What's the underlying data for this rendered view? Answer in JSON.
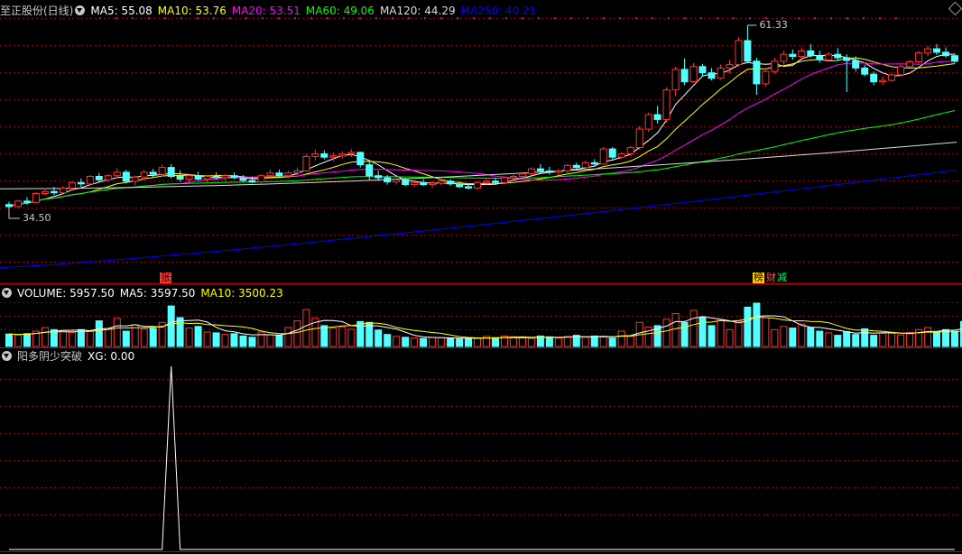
{
  "main_panel": {
    "title": "至正股份(日线)",
    "indicators": [
      {
        "label": "MA5: 55.08",
        "color": "#ffffff"
      },
      {
        "label": "MA10: 53.76",
        "color": "#ffff00"
      },
      {
        "label": "MA20: 53.51",
        "color": "#ff00ff"
      },
      {
        "label": "MA60: 49.06",
        "color": "#00ff00"
      },
      {
        "label": "MA120: 44.29",
        "color": "#dcdcdc"
      },
      {
        "label": "MA250: 40.21",
        "color": "#0000ff"
      }
    ],
    "high_label": "61.33",
    "low_label": "34.50",
    "event_tags": [
      {
        "text": "张",
        "bg": "#ff3333",
        "color": "#000000"
      },
      {
        "text": "榜",
        "bg": "#ffcc00",
        "color": "#000000"
      },
      {
        "text": "财",
        "bg": "#000000",
        "color": "#ff5555"
      },
      {
        "text": "减",
        "bg": "#000000",
        "color": "#00ff66"
      }
    ]
  },
  "volume_panel": {
    "indicators": [
      {
        "label": "VOLUME: 5957.50",
        "color": "#ffffff"
      },
      {
        "label": "MA5: 3597.50",
        "color": "#ffffff"
      },
      {
        "label": "MA10: 3500.23",
        "color": "#ffff00"
      }
    ]
  },
  "xg_panel": {
    "title": "阳多阴少突破",
    "indicators": [
      {
        "label": "XG: 0.00",
        "color": "#ffffff"
      }
    ]
  },
  "colors": {
    "up": "#ff3232",
    "down": "#54ffff",
    "grid": "#8b0000",
    "divider": "#c80000"
  },
  "chart_data": {
    "type": "candlestick",
    "price_range": [
      34.5,
      61.33
    ],
    "candles": [
      {
        "o": 35.2,
        "h": 35.6,
        "l": 34.5,
        "c": 34.9
      },
      {
        "o": 34.9,
        "h": 35.9,
        "l": 34.7,
        "c": 35.7
      },
      {
        "o": 35.7,
        "h": 36.3,
        "l": 35.2,
        "c": 35.5
      },
      {
        "o": 35.5,
        "h": 37.0,
        "l": 35.4,
        "c": 36.8
      },
      {
        "o": 36.8,
        "h": 37.6,
        "l": 36.5,
        "c": 37.1
      },
      {
        "o": 37.1,
        "h": 37.8,
        "l": 36.6,
        "c": 36.9
      },
      {
        "o": 36.9,
        "h": 37.9,
        "l": 36.8,
        "c": 37.6
      },
      {
        "o": 37.6,
        "h": 38.6,
        "l": 37.2,
        "c": 38.4
      },
      {
        "o": 38.4,
        "h": 39.0,
        "l": 37.8,
        "c": 38.2
      },
      {
        "o": 38.2,
        "h": 39.5,
        "l": 38.0,
        "c": 39.3
      },
      {
        "o": 39.3,
        "h": 39.8,
        "l": 38.5,
        "c": 38.8
      },
      {
        "o": 38.8,
        "h": 39.6,
        "l": 38.4,
        "c": 39.4
      },
      {
        "o": 39.4,
        "h": 40.5,
        "l": 39.0,
        "c": 39.9
      },
      {
        "o": 39.9,
        "h": 40.3,
        "l": 38.3,
        "c": 38.6
      },
      {
        "o": 38.6,
        "h": 39.4,
        "l": 38.0,
        "c": 39.2
      },
      {
        "o": 39.2,
        "h": 40.2,
        "l": 38.9,
        "c": 39.9
      },
      {
        "o": 39.9,
        "h": 40.4,
        "l": 39.1,
        "c": 39.6
      },
      {
        "o": 39.6,
        "h": 41.0,
        "l": 39.3,
        "c": 40.6
      },
      {
        "o": 40.6,
        "h": 41.1,
        "l": 39.0,
        "c": 39.3
      },
      {
        "o": 39.3,
        "h": 40.2,
        "l": 38.5,
        "c": 38.9
      },
      {
        "o": 38.9,
        "h": 39.6,
        "l": 38.2,
        "c": 39.4
      },
      {
        "o": 39.4,
        "h": 40.0,
        "l": 38.7,
        "c": 38.9
      },
      {
        "o": 38.9,
        "h": 39.5,
        "l": 38.4,
        "c": 39.3
      },
      {
        "o": 39.3,
        "h": 39.9,
        "l": 38.9,
        "c": 39.1
      },
      {
        "o": 39.1,
        "h": 39.6,
        "l": 38.6,
        "c": 39.4
      },
      {
        "o": 39.4,
        "h": 39.9,
        "l": 38.9,
        "c": 39.1
      },
      {
        "o": 39.1,
        "h": 39.5,
        "l": 38.5,
        "c": 38.7
      },
      {
        "o": 38.7,
        "h": 39.3,
        "l": 38.3,
        "c": 38.5
      },
      {
        "o": 38.5,
        "h": 39.6,
        "l": 38.3,
        "c": 39.4
      },
      {
        "o": 39.4,
        "h": 40.3,
        "l": 39.2,
        "c": 39.8
      },
      {
        "o": 39.8,
        "h": 40.3,
        "l": 39.1,
        "c": 39.4
      },
      {
        "o": 39.4,
        "h": 40.1,
        "l": 39.0,
        "c": 39.8
      },
      {
        "o": 39.8,
        "h": 40.6,
        "l": 39.5,
        "c": 40.1
      },
      {
        "o": 40.1,
        "h": 42.6,
        "l": 40.0,
        "c": 42.2
      },
      {
        "o": 42.2,
        "h": 43.2,
        "l": 41.6,
        "c": 42.6
      },
      {
        "o": 42.6,
        "h": 43.1,
        "l": 41.8,
        "c": 42.1
      },
      {
        "o": 42.1,
        "h": 42.8,
        "l": 41.5,
        "c": 42.3
      },
      {
        "o": 42.3,
        "h": 43.0,
        "l": 41.9,
        "c": 42.6
      },
      {
        "o": 42.6,
        "h": 43.3,
        "l": 42.1,
        "c": 42.8
      },
      {
        "o": 42.8,
        "h": 42.9,
        "l": 40.6,
        "c": 41.0
      },
      {
        "o": 41.0,
        "h": 41.7,
        "l": 38.7,
        "c": 39.4
      },
      {
        "o": 39.4,
        "h": 40.1,
        "l": 38.6,
        "c": 39.1
      },
      {
        "o": 39.1,
        "h": 39.5,
        "l": 38.1,
        "c": 38.5
      },
      {
        "o": 38.5,
        "h": 39.1,
        "l": 38.1,
        "c": 38.8
      },
      {
        "o": 38.8,
        "h": 39.1,
        "l": 37.9,
        "c": 38.1
      },
      {
        "o": 38.1,
        "h": 38.8,
        "l": 37.8,
        "c": 38.4
      },
      {
        "o": 38.4,
        "h": 38.9,
        "l": 37.9,
        "c": 38.1
      },
      {
        "o": 38.1,
        "h": 38.6,
        "l": 37.6,
        "c": 38.3
      },
      {
        "o": 38.3,
        "h": 38.8,
        "l": 38.0,
        "c": 38.6
      },
      {
        "o": 38.6,
        "h": 38.9,
        "l": 37.9,
        "c": 38.2
      },
      {
        "o": 38.2,
        "h": 38.6,
        "l": 37.6,
        "c": 37.8
      },
      {
        "o": 37.8,
        "h": 38.2,
        "l": 37.4,
        "c": 37.6
      },
      {
        "o": 37.6,
        "h": 38.6,
        "l": 37.5,
        "c": 38.4
      },
      {
        "o": 38.4,
        "h": 38.9,
        "l": 38.1,
        "c": 38.6
      },
      {
        "o": 38.6,
        "h": 39.1,
        "l": 38.2,
        "c": 38.4
      },
      {
        "o": 38.4,
        "h": 39.3,
        "l": 38.2,
        "c": 39.1
      },
      {
        "o": 39.1,
        "h": 39.6,
        "l": 38.8,
        "c": 39.3
      },
      {
        "o": 39.3,
        "h": 39.9,
        "l": 39.1,
        "c": 39.7
      },
      {
        "o": 39.7,
        "h": 40.6,
        "l": 39.5,
        "c": 40.4
      },
      {
        "o": 40.4,
        "h": 41.1,
        "l": 39.6,
        "c": 40.1
      },
      {
        "o": 40.1,
        "h": 40.7,
        "l": 39.6,
        "c": 39.9
      },
      {
        "o": 39.9,
        "h": 40.4,
        "l": 39.4,
        "c": 40.1
      },
      {
        "o": 40.1,
        "h": 41.1,
        "l": 39.9,
        "c": 40.9
      },
      {
        "o": 40.9,
        "h": 41.3,
        "l": 40.3,
        "c": 40.6
      },
      {
        "o": 40.6,
        "h": 41.6,
        "l": 40.4,
        "c": 41.3
      },
      {
        "o": 41.3,
        "h": 41.8,
        "l": 40.9,
        "c": 41.1
      },
      {
        "o": 41.1,
        "h": 43.6,
        "l": 41.0,
        "c": 43.3
      },
      {
        "o": 43.3,
        "h": 43.6,
        "l": 41.8,
        "c": 42.1
      },
      {
        "o": 42.1,
        "h": 42.8,
        "l": 41.9,
        "c": 42.6
      },
      {
        "o": 42.6,
        "h": 43.7,
        "l": 42.3,
        "c": 43.5
      },
      {
        "o": 43.5,
        "h": 46.6,
        "l": 43.2,
        "c": 46.2
      },
      {
        "o": 46.2,
        "h": 48.6,
        "l": 45.8,
        "c": 48.3
      },
      {
        "o": 48.3,
        "h": 49.6,
        "l": 47.0,
        "c": 47.6
      },
      {
        "o": 47.6,
        "h": 52.3,
        "l": 47.2,
        "c": 51.9
      },
      {
        "o": 51.9,
        "h": 55.3,
        "l": 51.0,
        "c": 54.9
      },
      {
        "o": 54.9,
        "h": 56.5,
        "l": 52.6,
        "c": 53.1
      },
      {
        "o": 53.1,
        "h": 55.8,
        "l": 52.9,
        "c": 55.3
      },
      {
        "o": 55.3,
        "h": 55.7,
        "l": 53.9,
        "c": 54.4
      },
      {
        "o": 54.4,
        "h": 55.1,
        "l": 53.3,
        "c": 53.6
      },
      {
        "o": 53.6,
        "h": 55.6,
        "l": 53.4,
        "c": 55.1
      },
      {
        "o": 55.1,
        "h": 56.3,
        "l": 54.3,
        "c": 55.6
      },
      {
        "o": 55.6,
        "h": 59.6,
        "l": 55.3,
        "c": 59.1
      },
      {
        "o": 59.1,
        "h": 61.33,
        "l": 55.8,
        "c": 56.1
      },
      {
        "o": 56.1,
        "h": 56.6,
        "l": 51.2,
        "c": 52.8
      },
      {
        "o": 52.8,
        "h": 55.1,
        "l": 52.4,
        "c": 54.6
      },
      {
        "o": 54.6,
        "h": 56.6,
        "l": 54.2,
        "c": 56.1
      },
      {
        "o": 56.1,
        "h": 57.6,
        "l": 55.6,
        "c": 57.1
      },
      {
        "o": 57.1,
        "h": 57.8,
        "l": 56.3,
        "c": 56.8
      },
      {
        "o": 56.8,
        "h": 58.1,
        "l": 56.5,
        "c": 57.6
      },
      {
        "o": 57.6,
        "h": 58.6,
        "l": 56.6,
        "c": 56.9
      },
      {
        "o": 56.9,
        "h": 57.6,
        "l": 55.9,
        "c": 56.3
      },
      {
        "o": 56.3,
        "h": 57.4,
        "l": 56.1,
        "c": 57.1
      },
      {
        "o": 57.1,
        "h": 58.0,
        "l": 56.2,
        "c": 56.6
      },
      {
        "o": 56.6,
        "h": 57.1,
        "l": 51.6,
        "c": 56.2
      },
      {
        "o": 56.2,
        "h": 56.8,
        "l": 54.6,
        "c": 55.1
      },
      {
        "o": 55.1,
        "h": 55.6,
        "l": 53.9,
        "c": 54.2
      },
      {
        "o": 54.2,
        "h": 54.6,
        "l": 52.6,
        "c": 53.1
      },
      {
        "o": 53.1,
        "h": 53.9,
        "l": 52.6,
        "c": 53.3
      },
      {
        "o": 53.3,
        "h": 54.4,
        "l": 53.1,
        "c": 54.1
      },
      {
        "o": 54.1,
        "h": 55.6,
        "l": 53.9,
        "c": 55.3
      },
      {
        "o": 55.3,
        "h": 56.3,
        "l": 55.1,
        "c": 56.0
      },
      {
        "o": 56.0,
        "h": 57.6,
        "l": 55.8,
        "c": 57.3
      },
      {
        "o": 57.3,
        "h": 58.3,
        "l": 56.8,
        "c": 57.9
      },
      {
        "o": 57.9,
        "h": 58.6,
        "l": 57.0,
        "c": 57.4
      },
      {
        "o": 57.4,
        "h": 58.1,
        "l": 56.6,
        "c": 56.9
      },
      {
        "o": 56.9,
        "h": 57.2,
        "l": 55.8,
        "c": 56.1
      }
    ],
    "volume": [
      310,
      290,
      320,
      380,
      470,
      420,
      400,
      350,
      420,
      380,
      640,
      450,
      700,
      380,
      540,
      430,
      450,
      600,
      1010,
      720,
      460,
      500,
      360,
      340,
      300,
      320,
      260,
      230,
      360,
      290,
      280,
      470,
      640,
      920,
      700,
      520,
      460,
      490,
      430,
      620,
      600,
      410,
      300,
      250,
      230,
      210,
      200,
      230,
      220,
      210,
      190,
      200,
      200,
      250,
      220,
      260,
      240,
      220,
      200,
      260,
      240,
      210,
      250,
      280,
      230,
      260,
      240,
      210,
      380,
      260,
      600,
      480,
      520,
      680,
      820,
      600,
      900,
      720,
      520,
      650,
      420,
      630,
      980,
      1080,
      720,
      420,
      500,
      460,
      560,
      470,
      380,
      340,
      280,
      370,
      300,
      440,
      280,
      330,
      340,
      290,
      350,
      420,
      470,
      350,
      420,
      380,
      620
    ],
    "xg_signal_index": 18,
    "xg_signal_value": 1
  }
}
